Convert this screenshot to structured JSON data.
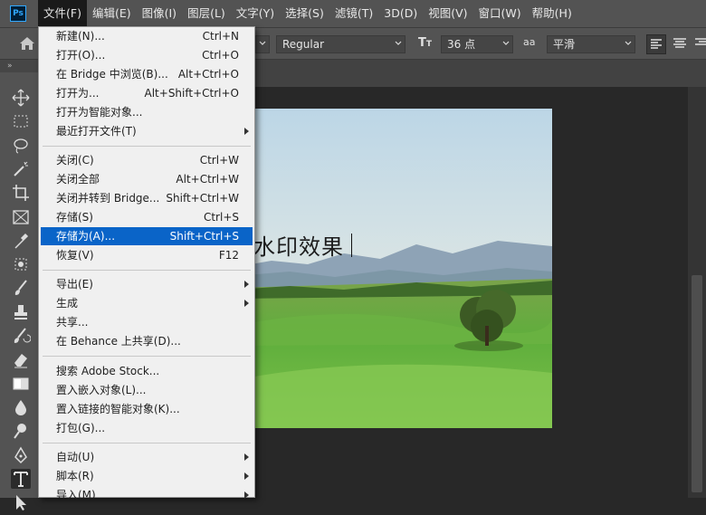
{
  "app": {
    "logo": "Ps"
  },
  "menubar": {
    "items": [
      {
        "label": "文件(F)",
        "active": true
      },
      {
        "label": "编辑(E)"
      },
      {
        "label": "图像(I)"
      },
      {
        "label": "图层(L)"
      },
      {
        "label": "文字(Y)"
      },
      {
        "label": "选择(S)"
      },
      {
        "label": "滤镜(T)"
      },
      {
        "label": "3D(D)"
      },
      {
        "label": "视图(V)"
      },
      {
        "label": "窗口(W)"
      },
      {
        "label": "帮助(H)"
      }
    ]
  },
  "options": {
    "font_style": "Regular",
    "font_size": "36 点",
    "size_icon": "T",
    "aa_icon": "aa",
    "antialias": "平滑"
  },
  "toolbar": {
    "collapse": "»",
    "tools": [
      "move-tool",
      "marquee-tool",
      "lasso-tool",
      "magic-wand-tool",
      "crop-tool",
      "frame-tool",
      "eyedropper-tool",
      "patch-tool",
      "brush-tool",
      "stamp-tool",
      "history-brush-tool",
      "eraser-tool",
      "gradient-tool",
      "blur-tool",
      "dodge-tool",
      "pen-tool",
      "type-tool",
      "path-select-tool"
    ],
    "selected": "type-tool"
  },
  "canvas": {
    "watermark_text": "水印效果"
  },
  "file_menu": [
    {
      "label": "新建(N)...",
      "shortcut": "Ctrl+N",
      "enabled": true
    },
    {
      "label": "打开(O)...",
      "shortcut": "Ctrl+O",
      "enabled": true
    },
    {
      "label": "在 Bridge 中浏览(B)...",
      "shortcut": "Alt+Ctrl+O",
      "enabled": true
    },
    {
      "label": "打开为...",
      "shortcut": "Alt+Shift+Ctrl+O",
      "enabled": true
    },
    {
      "label": "打开为智能对象...",
      "shortcut": "",
      "enabled": true
    },
    {
      "label": "最近打开文件(T)",
      "shortcut": "",
      "enabled": true,
      "submenu": true
    },
    {
      "separator": true
    },
    {
      "label": "关闭(C)",
      "shortcut": "Ctrl+W",
      "enabled": true
    },
    {
      "label": "关闭全部",
      "shortcut": "Alt+Ctrl+W",
      "enabled": true
    },
    {
      "label": "关闭并转到 Bridge...",
      "shortcut": "Shift+Ctrl+W",
      "enabled": true
    },
    {
      "label": "存储(S)",
      "shortcut": "Ctrl+S",
      "enabled": true
    },
    {
      "label": "存储为(A)...",
      "shortcut": "Shift+Ctrl+S",
      "enabled": true,
      "highlighted": true
    },
    {
      "label": "恢复(V)",
      "shortcut": "F12",
      "enabled": true
    },
    {
      "separator": true
    },
    {
      "label": "导出(E)",
      "shortcut": "",
      "enabled": true,
      "submenu": true
    },
    {
      "label": "生成",
      "shortcut": "",
      "enabled": true,
      "submenu": true
    },
    {
      "label": "共享...",
      "shortcut": "",
      "enabled": true
    },
    {
      "label": "在 Behance 上共享(D)...",
      "shortcut": "",
      "enabled": true
    },
    {
      "separator": true
    },
    {
      "label": "搜索 Adobe Stock...",
      "shortcut": "",
      "enabled": true
    },
    {
      "label": "置入嵌入对象(L)...",
      "shortcut": "",
      "enabled": true
    },
    {
      "label": "置入链接的智能对象(K)...",
      "shortcut": "",
      "enabled": true
    },
    {
      "label": "打包(G)...",
      "shortcut": "",
      "enabled": true
    },
    {
      "separator": true
    },
    {
      "label": "自动(U)",
      "shortcut": "",
      "enabled": true,
      "submenu": true
    },
    {
      "label": "脚本(R)",
      "shortcut": "",
      "enabled": true,
      "submenu": true
    },
    {
      "label": "导入(M)",
      "shortcut": "",
      "enabled": true,
      "submenu": true
    }
  ],
  "colors": {
    "menubar_bg": "#535353",
    "menu_highlight": "#0a64c8",
    "menu_bg": "#f0f0f0",
    "canvas_bg": "#282828"
  }
}
